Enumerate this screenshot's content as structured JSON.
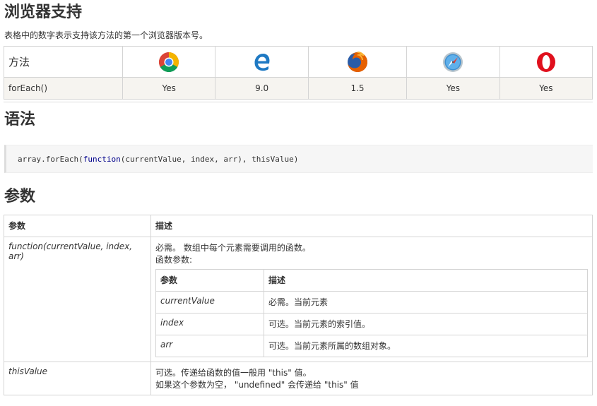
{
  "browser_support": {
    "title": "浏览器支持",
    "description": "表格中的数字表示支持该方法的第一个浏览器版本号。",
    "header_label": "方法",
    "browsers": [
      {
        "name": "chrome-icon",
        "version": "Yes"
      },
      {
        "name": "ie-edge-icon",
        "version": "9.0"
      },
      {
        "name": "firefox-icon",
        "version": "1.5"
      },
      {
        "name": "safari-icon",
        "version": "Yes"
      },
      {
        "name": "opera-icon",
        "version": "Yes"
      }
    ],
    "method": "forEach()"
  },
  "syntax": {
    "title": "语法",
    "code_obj": "array.forEach(",
    "code_kw": "function",
    "code_rest": "(currentValue, index, arr), thisValue)"
  },
  "params": {
    "title": "参数",
    "col1": "参数",
    "col2": "描述",
    "rows": [
      {
        "name": "function(currentValue, index, arr)",
        "desc_line1": "必需。 数组中每个元素需要调用的函数。",
        "desc_line2": "函数参数:",
        "nested": {
          "col1": "参数",
          "col2": "描述",
          "rows": [
            {
              "name": "currentValue",
              "desc": "必需。当前元素"
            },
            {
              "name": "index",
              "desc": "可选。当前元素的索引值。"
            },
            {
              "name": "arr",
              "desc": "可选。当前元素所属的数组对象。"
            }
          ]
        }
      },
      {
        "name": "thisValue",
        "desc_line1": "可选。传递给函数的值一般用 \"this\" 值。",
        "desc_line2": "如果这个参数为空， \"undefined\" 会传递给 \"this\" 值"
      }
    ]
  }
}
